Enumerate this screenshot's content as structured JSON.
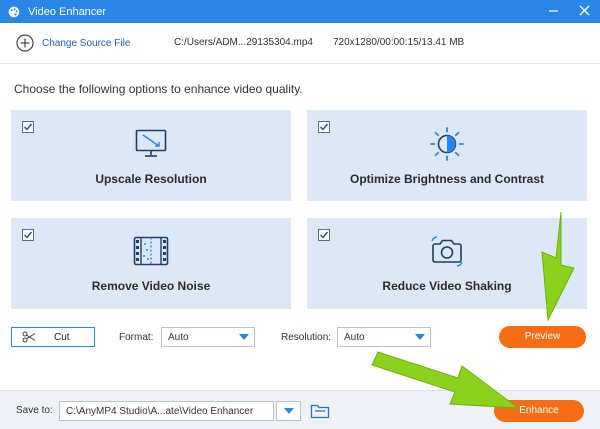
{
  "window": {
    "title": "Video Enhancer",
    "minimize_icon": "minimize-icon",
    "close_icon": "close-icon"
  },
  "source": {
    "change_label": "Change Source File",
    "path": "C:/Users/ADM...29135304.mp4",
    "info": "720x1280/00:00:15/13.41 MB"
  },
  "prompt": "Choose the following options to enhance video quality.",
  "options": [
    {
      "label": "Upscale Resolution",
      "checked": true,
      "icon": "monitor-upscale-icon"
    },
    {
      "label": "Optimize Brightness and Contrast",
      "checked": true,
      "icon": "brightness-icon"
    },
    {
      "label": "Remove Video Noise",
      "checked": true,
      "icon": "film-noise-icon"
    },
    {
      "label": "Reduce Video Shaking",
      "checked": true,
      "icon": "camera-stabilize-icon"
    }
  ],
  "controls": {
    "cut_label": "Cut",
    "format_label": "Format:",
    "format_value": "Auto",
    "resolution_label": "Resolution:",
    "resolution_value": "Auto",
    "preview_label": "Preview"
  },
  "bottom": {
    "save_to_label": "Save to:",
    "save_path": "C:\\AnyMP4 Studio\\A...ate\\Video Enhancer",
    "enhance_label": "Enhance"
  },
  "colors": {
    "title_bar": "#2a86e6",
    "card_bg": "#dde8f6",
    "button_orange": "#f86d14",
    "arrow_green": "#8cd21c"
  }
}
